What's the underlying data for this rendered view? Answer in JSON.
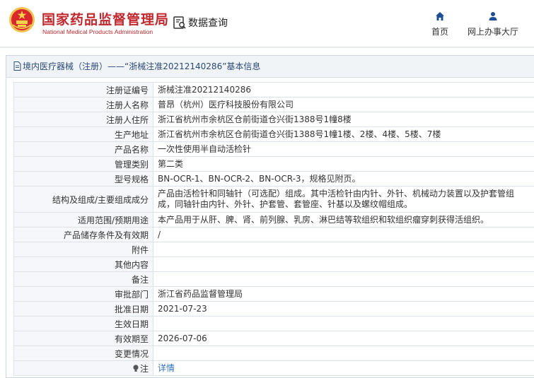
{
  "header": {
    "logo_cn": "国家药品监督管理局",
    "logo_en": "National Medical Products Administration",
    "query_label": "数据查询",
    "nav": [
      {
        "label": "首页",
        "icon": "home-icon"
      },
      {
        "label": "网上办事大厅",
        "icon": "user-icon"
      }
    ]
  },
  "panel": {
    "title": "境内医疗器械（注册）——“浙械注准20212140286”基本信息"
  },
  "rows": [
    {
      "key": "注册证编号",
      "value": "浙械注准20212140286"
    },
    {
      "key": "注册人名称",
      "value": "普昂（杭州）医疗科技股份有限公司"
    },
    {
      "key": "注册人住所",
      "value": "浙江省杭州市余杭区仓前街道仓兴街1388号1幢8楼"
    },
    {
      "key": "生产地址",
      "value": "浙江省杭州市余杭区仓前街道仓兴街1388号1幢1楼、2楼、4楼、5楼、7楼"
    },
    {
      "key": "产品名称",
      "value": "一次性使用半自动活检针"
    },
    {
      "key": "管理类别",
      "value": "第二类"
    },
    {
      "key": "型号规格",
      "value": "BN-OCR-1、BN-OCR-2、BN-OCR-3，规格见附页。"
    },
    {
      "key": "结构及组成/主要组成成分",
      "value": "产品由活检针和同轴针（可选配）组成。其中活检针由内针、外针、机械动力装置以及护套管组成，同轴针由内针、外针、护套管、套管座、针基以及螺纹帽组成。"
    },
    {
      "key": "适用范围/预期用途",
      "value": "本产品用于从肝、脾、肾、前列腺、乳房、淋巴结等软组织和软组织瘤穿刺获得活组织。"
    },
    {
      "key": "产品储存条件及有效期",
      "value": "/"
    },
    {
      "key": "附件",
      "value": ""
    },
    {
      "key": "其他内容",
      "value": ""
    },
    {
      "key": "备注",
      "value": ""
    },
    {
      "key": "审批部门",
      "value": "浙江省药品监督管理局"
    },
    {
      "key": "批准日期",
      "value": "2021-07-23"
    },
    {
      "key": "生效日期",
      "value": ""
    },
    {
      "key": "有效期至",
      "value": "2026-07-06"
    },
    {
      "key": "变更情况",
      "value": ""
    }
  ],
  "note": {
    "key": "注",
    "link": "详情"
  },
  "colors": {
    "brand_red": "#c0282d",
    "title_blue": "#2a4a7a",
    "link_blue": "#2f6fbf",
    "key_bg": "#f5f7fa"
  }
}
